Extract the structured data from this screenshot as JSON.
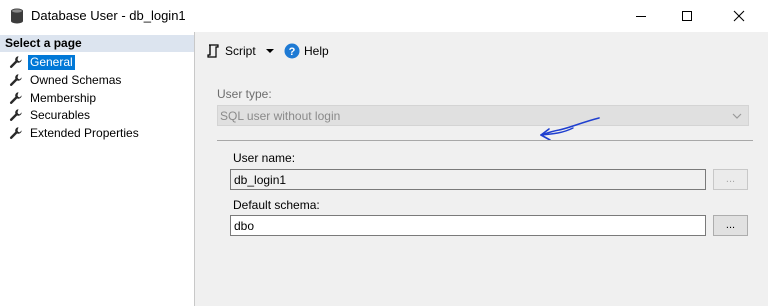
{
  "window": {
    "title": "Database User - db_login1"
  },
  "left_panel": {
    "header": "Select a page",
    "items": [
      {
        "label": "General",
        "selected": true
      },
      {
        "label": "Owned Schemas",
        "selected": false
      },
      {
        "label": "Membership",
        "selected": false
      },
      {
        "label": "Securables",
        "selected": false
      },
      {
        "label": "Extended Properties",
        "selected": false
      }
    ]
  },
  "toolbar": {
    "script_label": "Script",
    "help_label": "Help"
  },
  "form": {
    "user_type_label": "User type:",
    "user_type_value": "SQL user without login",
    "user_name_label": "User name:",
    "user_name_value": "db_login1",
    "default_schema_label": "Default schema:",
    "default_schema_value": "dbo",
    "browse_label": "..."
  },
  "colors": {
    "selection": "#0078d7",
    "page_header_bg": "#dce4ef",
    "annotation": "#1f3fcf"
  }
}
